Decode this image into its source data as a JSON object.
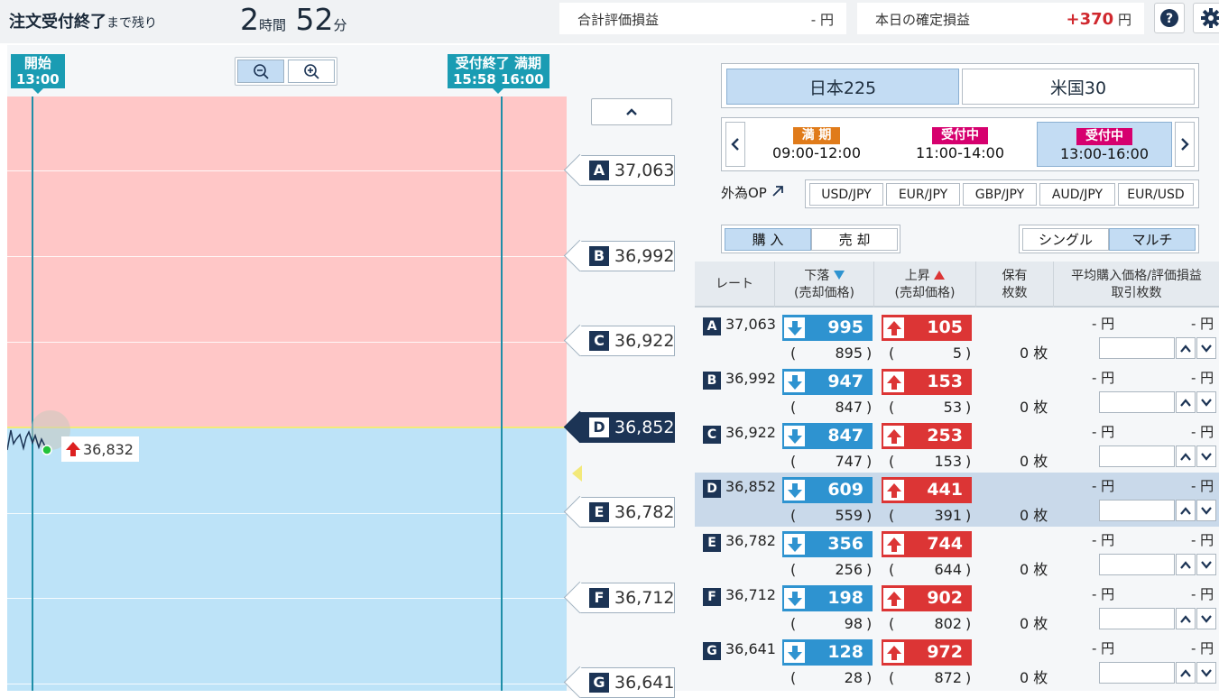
{
  "header": {
    "countdown_label": "注文受付終了",
    "countdown_suffix": "まで残り",
    "hours": "2",
    "hours_unit": "時間",
    "minutes": "52",
    "minutes_unit": "分",
    "total_pl_label": "合計評価損益",
    "total_pl_value": "-",
    "total_pl_unit": "円",
    "today_pl_label": "本日の確定損益",
    "today_pl_value": "+370",
    "today_pl_unit": "円",
    "help_icon": "help-icon",
    "settings_icon": "gear-icon",
    "accent_color": "#d0282e"
  },
  "chart": {
    "start_flag": [
      "開始",
      "13:00"
    ],
    "end_flag": [
      "受付終了",
      "15:58"
    ],
    "expiry_flag": [
      "満期",
      "16:00"
    ],
    "current_price": "36,832",
    "current_price_direction": "up",
    "current_level": "D",
    "up_zone_color": "#ffc7c7",
    "down_zone_color": "#bde3f8",
    "levels": [
      {
        "letter": "A",
        "price": "37,063"
      },
      {
        "letter": "B",
        "price": "36,992"
      },
      {
        "letter": "C",
        "price": "36,922"
      },
      {
        "letter": "D",
        "price": "36,852"
      },
      {
        "letter": "E",
        "price": "36,782"
      },
      {
        "letter": "F",
        "price": "36,712"
      },
      {
        "letter": "G",
        "price": "36,641"
      }
    ]
  },
  "products": {
    "tabs": [
      "日本225",
      "米国30"
    ],
    "selected": 0
  },
  "slots": [
    {
      "status": "満 期",
      "time": "09:00-12:00",
      "status_type": "expired"
    },
    {
      "status": "受付中",
      "time": "11:00-14:00",
      "status_type": "accepting"
    },
    {
      "status": "受付中",
      "time": "13:00-16:00",
      "status_type": "accepting",
      "selected": true
    }
  ],
  "fx": {
    "label": "外為OP",
    "pairs": [
      "USD/JPY",
      "EUR/JPY",
      "GBP/JPY",
      "AUD/JPY",
      "EUR/USD"
    ]
  },
  "trade_mode": {
    "buy": "購 入",
    "sell": "売 却",
    "selected": "buy"
  },
  "order_mode": {
    "single": "シングル",
    "multi": "マルチ",
    "selected": "multi"
  },
  "table": {
    "headers": {
      "rate": "レート",
      "down": "下落",
      "down_sub": "(売却価格)",
      "up": "上昇",
      "up_sub": "(売却価格)",
      "hold": "保有",
      "hold_sub": "枚数",
      "avg": "平均購入価格/評価損益",
      "avg_sub": "取引枚数"
    },
    "rows": [
      {
        "letter": "A",
        "rate": "37,063",
        "down": "995",
        "down_sell": "895",
        "up": "105",
        "up_sell": "5",
        "hold": "0 枚",
        "avg_price": "- 円",
        "pl": "- 円",
        "qty": ""
      },
      {
        "letter": "B",
        "rate": "36,992",
        "down": "947",
        "down_sell": "847",
        "up": "153",
        "up_sell": "53",
        "hold": "0 枚",
        "avg_price": "- 円",
        "pl": "- 円",
        "qty": ""
      },
      {
        "letter": "C",
        "rate": "36,922",
        "down": "847",
        "down_sell": "747",
        "up": "253",
        "up_sell": "153",
        "hold": "0 枚",
        "avg_price": "- 円",
        "pl": "- 円",
        "qty": ""
      },
      {
        "letter": "D",
        "rate": "36,852",
        "down": "609",
        "down_sell": "559",
        "up": "441",
        "up_sell": "391",
        "hold": "0 枚",
        "avg_price": "- 円",
        "pl": "- 円",
        "qty": "",
        "selected": true
      },
      {
        "letter": "E",
        "rate": "36,782",
        "down": "356",
        "down_sell": "256",
        "up": "744",
        "up_sell": "644",
        "hold": "0 枚",
        "avg_price": "- 円",
        "pl": "- 円",
        "qty": ""
      },
      {
        "letter": "F",
        "rate": "36,712",
        "down": "198",
        "down_sell": "98",
        "up": "902",
        "up_sell": "802",
        "hold": "0 枚",
        "avg_price": "- 円",
        "pl": "- 円",
        "qty": ""
      },
      {
        "letter": "G",
        "rate": "36,641",
        "down": "128",
        "down_sell": "28",
        "up": "972",
        "up_sell": "872",
        "hold": "0 枚",
        "avg_price": "- 円",
        "pl": "- 円",
        "qty": ""
      }
    ]
  }
}
